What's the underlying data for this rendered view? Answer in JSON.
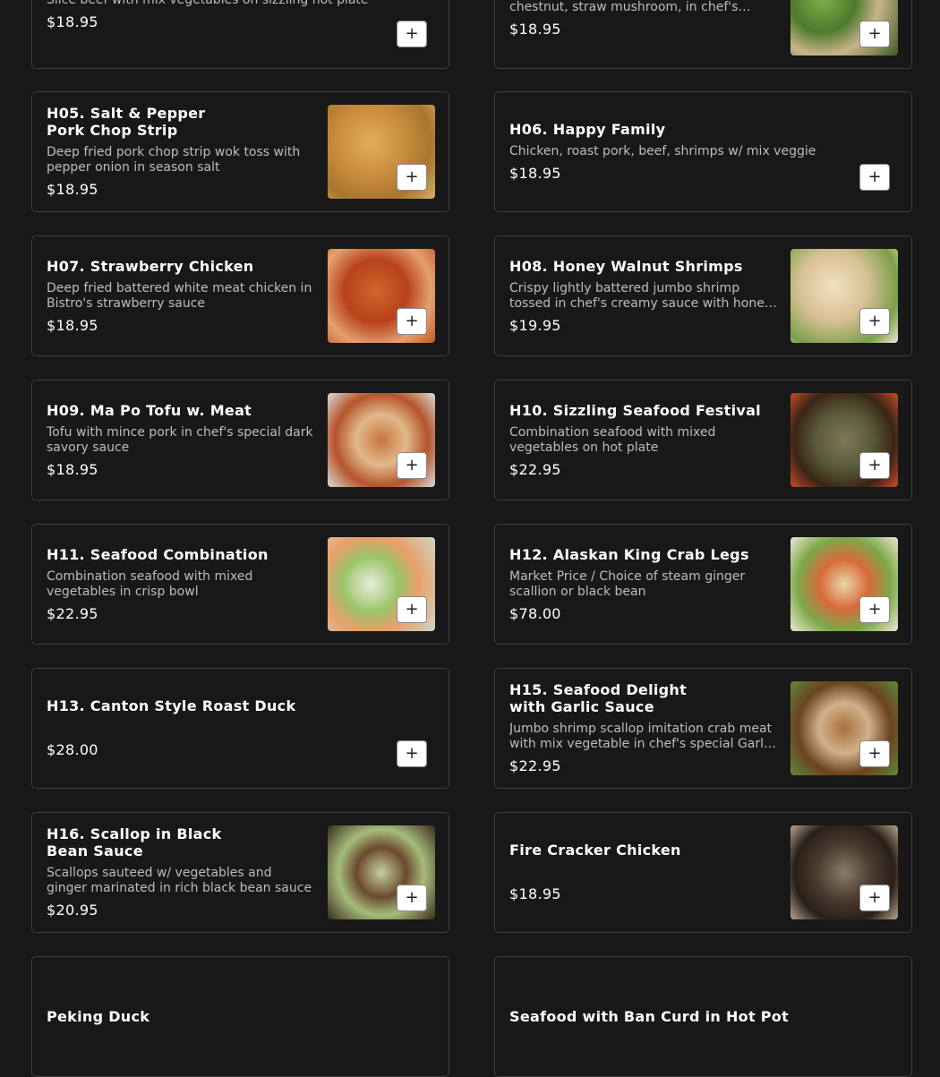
{
  "menu": {
    "items": [
      {
        "id": "h03",
        "title": "",
        "desc": "Slice beef with mix vegetables on sizzling hot plate",
        "price": "$18.95",
        "image": false,
        "tone": ""
      },
      {
        "id": "h04",
        "title": "",
        "desc": "Slice beef with asparagus, carrots, water chestnut, straw mushroom, in chef's special sauce",
        "price": "$18.95",
        "image": true,
        "tone": "green"
      },
      {
        "id": "h05",
        "title": "H05. Salt & Pepper Pork Chop Strip",
        "desc": "Deep fried pork chop strip wok toss with pepper onion in season salt",
        "price": "$18.95",
        "image": true,
        "tone": "golden"
      },
      {
        "id": "h06",
        "title": "H06. Happy Family",
        "desc": "Chicken, roast pork, beef, shrimps w/ mix veggie",
        "price": "$18.95",
        "image": false,
        "tone": ""
      },
      {
        "id": "h07",
        "title": "H07. Strawberry Chicken",
        "desc": "Deep fried battered white meat chicken in Bistro's strawberry sauce",
        "price": "$18.95",
        "image": true,
        "tone": "red"
      },
      {
        "id": "h08",
        "title": "H08. Honey Walnut Shrimps",
        "desc": "Crispy lightly battered jumbo shrimp tossed in chef's creamy sauce with honey walnuts",
        "price": "$19.95",
        "image": true,
        "tone": "cream"
      },
      {
        "id": "h09",
        "title": "H09. Ma Po Tofu w. Meat",
        "desc": "Tofu with mince pork in chef's special dark savory sauce",
        "price": "$18.95",
        "image": true,
        "tone": "tofu"
      },
      {
        "id": "h10",
        "title": "H10. Sizzling Seafood Festival",
        "desc": "Combination seafood with mixed vegetables on hot plate",
        "price": "$22.95",
        "image": true,
        "tone": "sizzle"
      },
      {
        "id": "h11",
        "title": "H11. Seafood Combination",
        "desc": "Combination seafood with mixed vegetables in crisp bowl",
        "price": "$22.95",
        "image": true,
        "tone": "veg"
      },
      {
        "id": "h12",
        "title": "H12. Alaskan King Crab Legs",
        "desc": "Market Price / Choice of steam ginger scallion or black bean",
        "price": "$78.00",
        "image": true,
        "tone": "crab"
      },
      {
        "id": "h13",
        "title": "H13. Canton Style Roast Duck",
        "desc": "",
        "price": "$28.00",
        "image": false,
        "tone": ""
      },
      {
        "id": "h15",
        "title": "H15. Seafood Delight with Garlic Sauce",
        "desc": "Jumbo shrimp scallop imitation crab meat with mix vegetable in chef's special Garlic sauce",
        "price": "$22.95",
        "image": true,
        "tone": "brown"
      },
      {
        "id": "h16",
        "title": "H16. Scallop in Black Bean Sauce",
        "desc": "Scallops sauteed w/ vegetables and ginger marinated in rich black bean sauce",
        "price": "$20.95",
        "image": true,
        "tone": "blackbean"
      },
      {
        "id": "fcc",
        "title": "Fire Cracker Chicken",
        "desc": "",
        "price": "$18.95",
        "image": true,
        "tone": "dark"
      },
      {
        "id": "peking",
        "title": "Peking Duck",
        "desc": "",
        "price": "",
        "image": false,
        "tone": ""
      },
      {
        "id": "seafood-hotpot",
        "title": "Seafood with Ban Curd in Hot Pot",
        "desc": "",
        "price": "",
        "image": false,
        "tone": ""
      }
    ]
  },
  "add_button_label": "+",
  "icons": {
    "add": "plus-icon"
  },
  "colors": {
    "background": "#181818",
    "card_border": "#3d3d3d",
    "text": "#ffffff",
    "muted": "#bdbdbd",
    "button_bg": "#ffffff"
  }
}
